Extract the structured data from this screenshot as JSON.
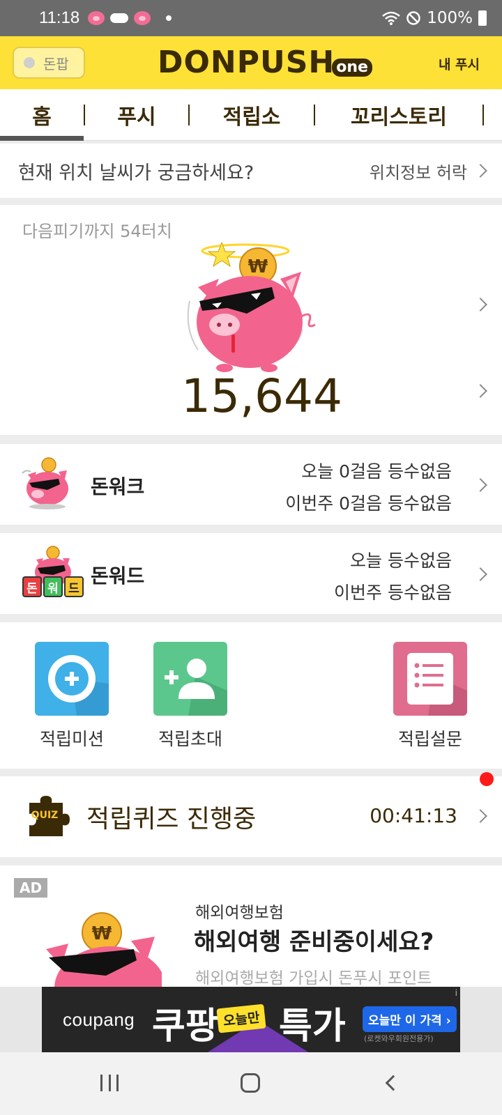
{
  "status_bar": {
    "time": "11:18",
    "battery": "100%"
  },
  "header": {
    "toggle_label": "돈팝",
    "logo_main": "DONPUSH",
    "logo_sub": "one",
    "my_push": "내 푸시"
  },
  "tabs": [
    {
      "label": "홈",
      "active": true
    },
    {
      "label": "푸시"
    },
    {
      "label": "적립소"
    },
    {
      "label": "꼬리스토리"
    }
  ],
  "weather": {
    "question": "현재 위치 날씨가 궁금하세요?",
    "action": "위치정보 허락"
  },
  "piggy": {
    "next_text": "다음피기까지 54터치",
    "amount": "15,644",
    "coin_symbol": "₩"
  },
  "donwalk": {
    "label": "돈워크",
    "today": "오늘 0걸음 등수없음",
    "week": "이번주 0걸음 등수없음"
  },
  "donword": {
    "label": "돈워드",
    "today": "오늘 등수없음",
    "week": "이번주 등수없음",
    "blocks": [
      "돈",
      "워",
      "드"
    ]
  },
  "menu": [
    {
      "label": "적립미션",
      "icon": "plus-circle-icon",
      "color": "#3fb0e8"
    },
    {
      "label": "적립초대",
      "icon": "add-person-icon",
      "color": "#5cc78c"
    },
    {
      "label": "적립설문",
      "icon": "survey-list-icon",
      "color": "#e06d8e"
    }
  ],
  "quiz": {
    "badge": "QUIZ",
    "label": "적립퀴즈 진행중",
    "timer": "00:41:13"
  },
  "ad": {
    "badge": "AD",
    "category": "해외여행보험",
    "headline": "해외여행 준비중이세요?",
    "description": "해외여행보험 가입시 돈푸시 포인트"
  },
  "banner": {
    "brand": "coupang",
    "big1": "쿠팡",
    "today": "오늘만",
    "big2": "특가",
    "button": "오늘만 이 가격 ›",
    "small": "(로켓와우회원전용가)",
    "info": "i"
  },
  "colors": {
    "brand_yellow": "#fde137",
    "brand_brown": "#3b2a06",
    "pig_pink": "#f26d95",
    "alert_red": "#ff1a1a"
  }
}
